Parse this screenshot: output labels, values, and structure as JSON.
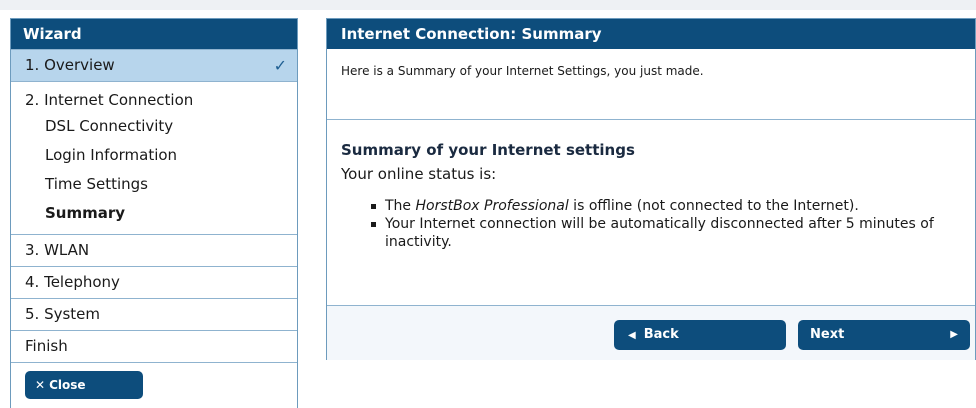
{
  "sidebar": {
    "title": "Wizard",
    "overview": "1. Overview",
    "internet": {
      "title": "2. Internet Connection",
      "subitems": [
        "DSL Connectivity",
        "Login Information",
        "Time Settings",
        "Summary"
      ]
    },
    "wlan": "3. WLAN",
    "telephony": "4. Telephony",
    "system": "5. System",
    "finish": "Finish",
    "close_label": "Close"
  },
  "panel": {
    "title": "Internet Connection: Summary",
    "intro": "Here is a Summary of your Internet Settings, you just made.",
    "summary_title": "Summary of your Internet settings",
    "status_label": "Your online status is:",
    "bullet1": {
      "pre": "The ",
      "product": "HorstBox Professional",
      "post": " is offline (not connected to the Internet)."
    },
    "bullet2": "Your Internet connection will be automatically disconnected after 5 minutes of inactivity.",
    "back_label": "Back",
    "next_label": "Next"
  },
  "icons": {
    "check": "checkmark-icon",
    "close": "close-icon",
    "back": "arrow-left-icon",
    "next": "arrow-right-icon"
  },
  "colors": {
    "header_bg": "#0d4d7c",
    "active_bg": "#b7d5ec",
    "border": "#6d9bbd"
  }
}
